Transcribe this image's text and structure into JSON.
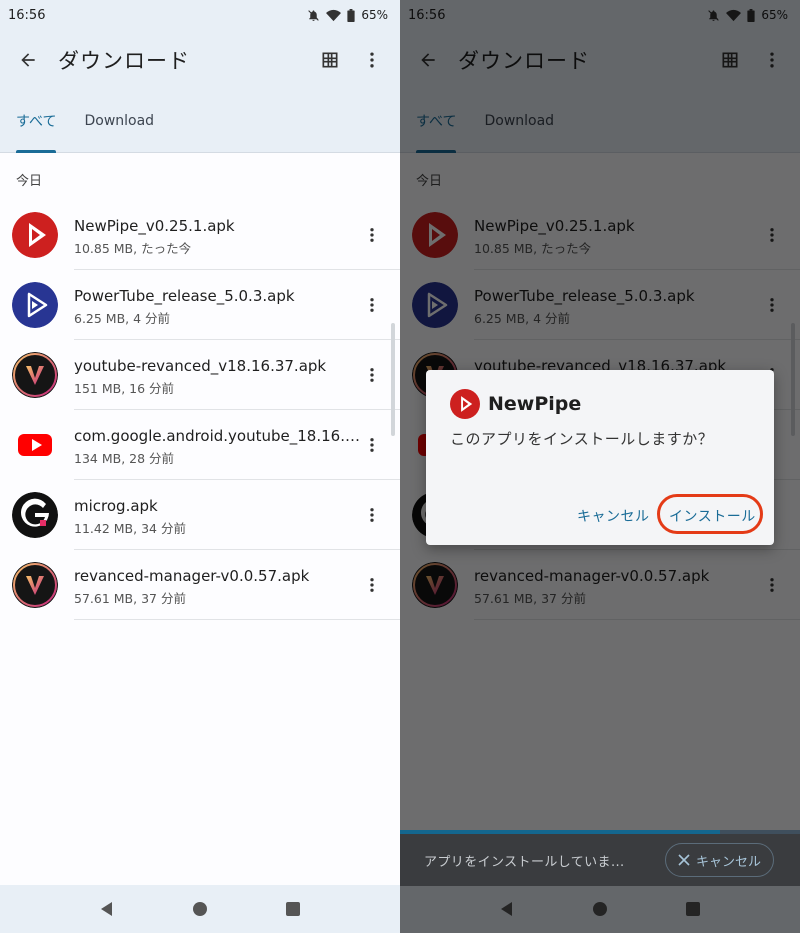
{
  "status": {
    "time": "16:56",
    "battery": "65%"
  },
  "appbar": {
    "title": "ダウンロード"
  },
  "tabs": [
    {
      "label": "すべて"
    },
    {
      "label": "Download"
    }
  ],
  "section_label": "今日",
  "files": [
    {
      "name": "NewPipe_v0.25.1.apk",
      "meta": "10.85 MB, たった今",
      "icon": "newpipe-icon"
    },
    {
      "name": "PowerTube_release_5.0.3.apk",
      "meta": "6.25 MB, 4 分前",
      "icon": "powertube-icon"
    },
    {
      "name": "youtube-revanced_v18.16.37.apk",
      "meta": "151 MB, 16 分前",
      "icon": "revanced-icon"
    },
    {
      "name": "com.google.android.youtube_18.16.3...",
      "meta": "134 MB, 28 分前",
      "icon": "youtube-icon"
    },
    {
      "name": "microg.apk",
      "meta": "11.42 MB, 34 分前",
      "icon": "microg-icon"
    },
    {
      "name": "revanced-manager-v0.0.57.apk",
      "meta": "57.61 MB, 37 分前",
      "icon": "revanced-manager-icon"
    }
  ],
  "dialog": {
    "app_name": "NewPipe",
    "message": "このアプリをインストールしますか？",
    "cancel_label": "キャンセル",
    "install_label": "インストール"
  },
  "install_bar": {
    "text": "アプリをインストールしていま...",
    "cancel_label": "キャンセル",
    "progress": 0.8
  },
  "colors": {
    "accent": "#1a6c97",
    "highlight": "#e43b17",
    "appbar": "#e8eff6"
  }
}
